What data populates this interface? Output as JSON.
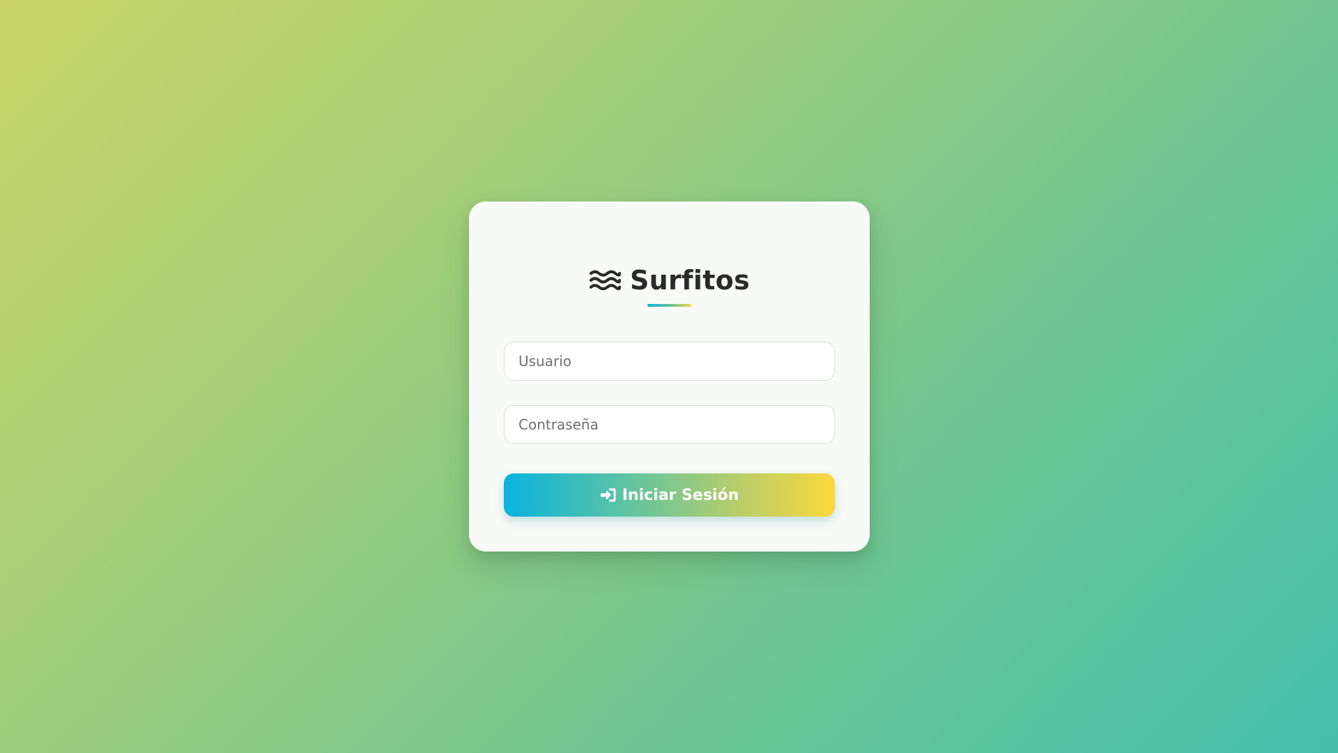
{
  "brand": {
    "title": "Surfitos",
    "icon": "water-waves-icon"
  },
  "form": {
    "username_placeholder": "Usuario",
    "username_value": "",
    "password_placeholder": "Contraseña",
    "password_value": "",
    "submit_label": "Iniciar Sesión",
    "submit_icon": "sign-in-icon"
  },
  "colors": {
    "accent_start": "#08b3df",
    "accent_end": "#fbd83c",
    "card_background": "#f8faf7",
    "title_text": "#2a2a2a"
  }
}
